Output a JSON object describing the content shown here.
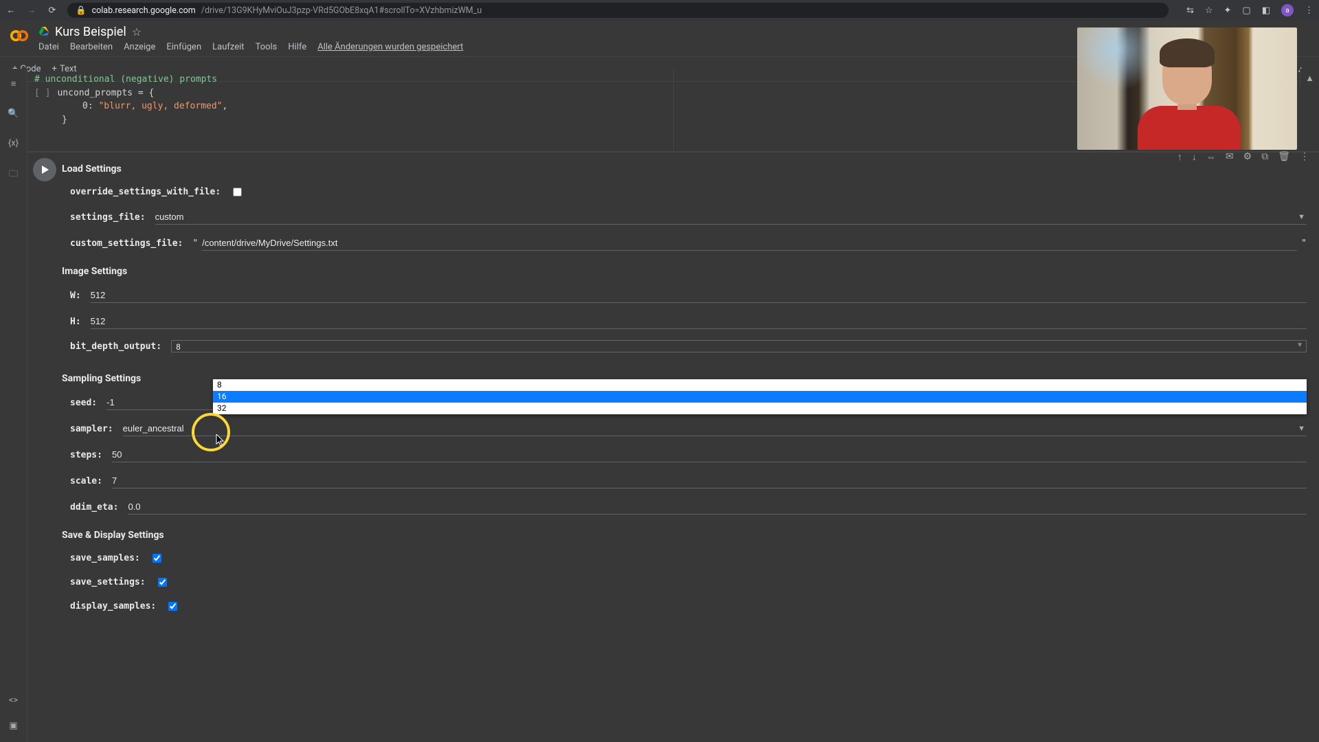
{
  "browser": {
    "url_host": "colab.research.google.com",
    "url_path": "/drive/13G9KHyMviOuJ3pzp-VRd5GObE8xqA1#scrollTo=XVzhbmizWM_u",
    "avatar_letter": "a"
  },
  "header": {
    "doc_title": "Kurs Beispiel",
    "menu": [
      "Datei",
      "Bearbeiten",
      "Anzeige",
      "Einfügen",
      "Laufzeit",
      "Tools",
      "Hilfe"
    ],
    "save_status": "Alle Änderungen wurden gespeichert",
    "toolbar": {
      "code": "Code",
      "text": "Text"
    }
  },
  "code_cell": {
    "bracket": "[ ]",
    "comment": "# unconditional (negative) prompts",
    "line1a": "uncond_prompts = {",
    "line2_key": "0",
    "line2_val": "\"blurr, ugly, deformed\"",
    "line2_after": ",",
    "line3": "    }"
  },
  "cell_toolbar_icons": [
    "↑",
    "↓",
    "⇔",
    "✉",
    "⚙",
    "⧉",
    "🗑",
    "⋮"
  ],
  "form": {
    "sec_load": "Load Settings",
    "override_label": "override_settings_with_file:",
    "settings_file_label": "settings_file:",
    "settings_file_value": "custom",
    "custom_file_label": "custom_settings_file:",
    "custom_file_value": "/content/drive/MyDrive/Settings.txt",
    "sec_image": "Image Settings",
    "w_label": "W:",
    "w_value": "512",
    "h_label": "H:",
    "h_value": "512",
    "bit_depth_label": "bit_depth_output:",
    "bit_depth_value": "8",
    "bit_depth_options": [
      "8",
      "16",
      "32"
    ],
    "sec_sampling": "Sampling Settings",
    "seed_label": "seed:",
    "seed_value": "-1",
    "sampler_label": "sampler:",
    "sampler_value": "euler_ancestral",
    "steps_label": "steps:",
    "steps_value": "50",
    "scale_label": "scale:",
    "scale_value": "7",
    "ddim_label": "ddim_eta:",
    "ddim_value": "0.0",
    "sec_save": "Save & Display Settings",
    "save_samples_label": "save_samples:",
    "save_settings_label": "save_settings:",
    "display_samples_label": "display_samples:"
  }
}
